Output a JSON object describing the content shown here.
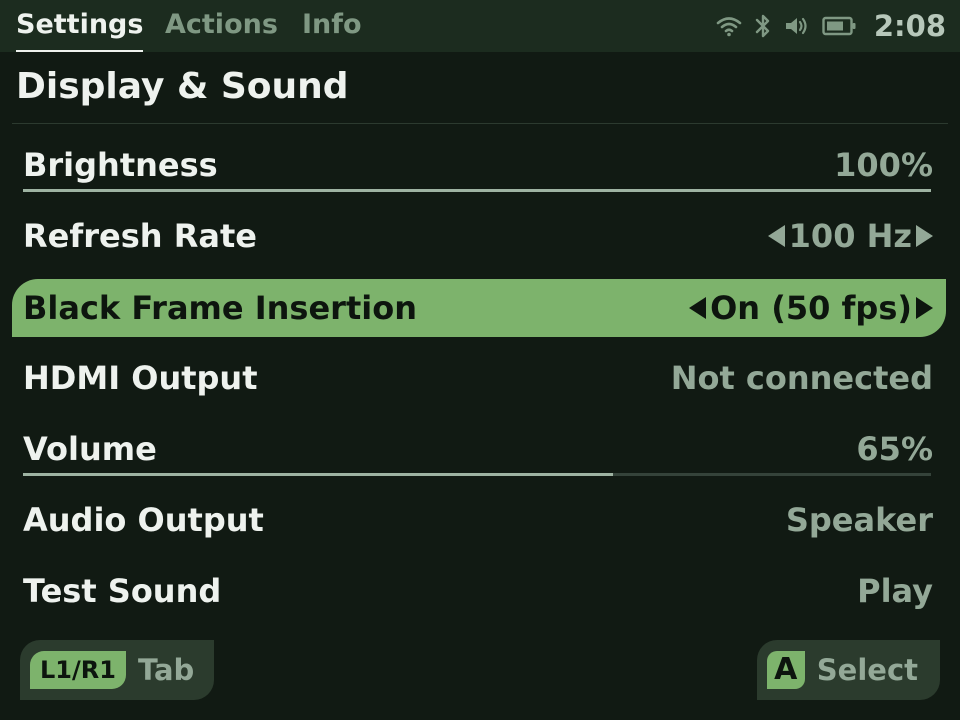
{
  "tabs": [
    {
      "label": "Settings",
      "active": true
    },
    {
      "label": "Actions",
      "active": false
    },
    {
      "label": "Info",
      "active": false
    }
  ],
  "status_bar": {
    "icons": [
      "wifi-icon",
      "bluetooth-icon",
      "volume-icon",
      "battery-icon"
    ],
    "clock": "2:08"
  },
  "section": {
    "title": "Display & Sound"
  },
  "settings": [
    {
      "label": "Brightness",
      "value": "100%",
      "type": "slider",
      "level": 1.0
    },
    {
      "label": "Refresh Rate",
      "value": "100 Hz",
      "type": "selector"
    },
    {
      "label": "Black Frame Insertion",
      "value": "On (50 fps)",
      "type": "selector",
      "selected": true
    },
    {
      "label": "HDMI Output",
      "value": "Not connected",
      "type": "info"
    },
    {
      "label": "Volume",
      "value": "65%",
      "type": "slider",
      "level": 0.65
    },
    {
      "label": "Audio Output",
      "value": "Speaker",
      "type": "info"
    },
    {
      "label": "Test Sound",
      "value": "Play",
      "type": "action"
    }
  ],
  "footer": {
    "left_key": "L1/R1",
    "left_label": "Tab",
    "right_key": "A",
    "right_label": "Select"
  },
  "colors": {
    "background": "#111a13",
    "topbar": "#1c2c1f",
    "accent": "#7db36c",
    "text_primary": "#eef2ee",
    "text_secondary": "#93a897"
  }
}
